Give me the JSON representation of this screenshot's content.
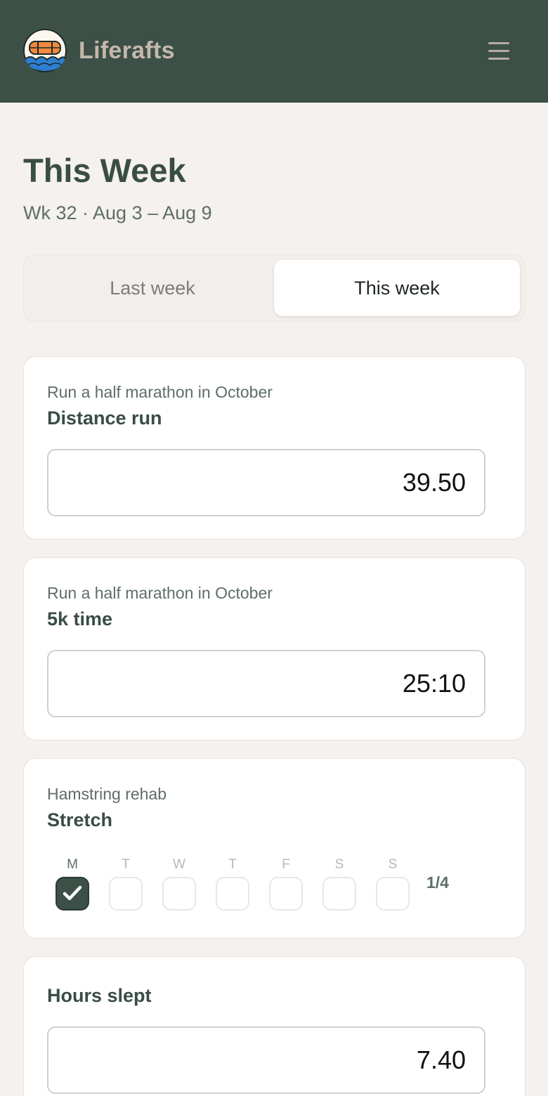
{
  "app": {
    "name": "Liferafts"
  },
  "header": {
    "menu_icon": "hamburger-icon",
    "logo_icon": "liferaft-logo"
  },
  "page": {
    "title": "This Week",
    "subtitle": "Wk 32 · Aug 3 – Aug 9"
  },
  "week_toggle": {
    "last": "Last week",
    "this": "This week",
    "selected": "This week"
  },
  "cards": [
    {
      "goal": "Run a half marathon in October",
      "metric": "Distance run",
      "value": "39.50"
    },
    {
      "goal": "Run a half marathon in October",
      "metric": "5k time",
      "value": "25:10"
    },
    {
      "goal": "Hamstring rehab",
      "metric": "Stretch",
      "days": [
        {
          "letter": "M",
          "checked": true
        },
        {
          "letter": "T",
          "checked": false
        },
        {
          "letter": "W",
          "checked": false
        },
        {
          "letter": "T",
          "checked": false
        },
        {
          "letter": "F",
          "checked": false
        },
        {
          "letter": "S",
          "checked": false
        },
        {
          "letter": "S",
          "checked": false
        }
      ],
      "progress": "1/4"
    },
    {
      "metric": "Hours slept",
      "value": "7.40"
    }
  ],
  "colors": {
    "header_bg": "#3c5048",
    "accent": "#3a4d45",
    "page_bg": "#f4f1ee"
  }
}
